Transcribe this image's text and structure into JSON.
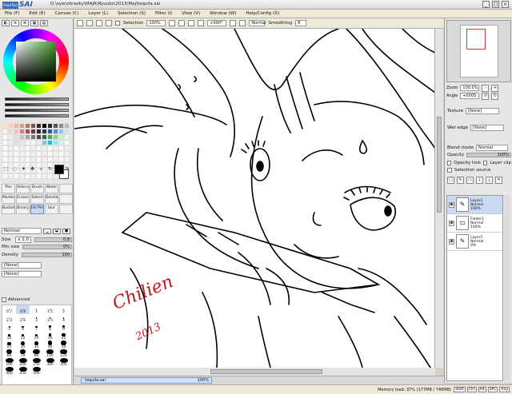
{
  "app": {
    "logo_small": "PaintTool",
    "logo_name": "SAI",
    "title": "D:\\syw\\obrazky\\MAJA\\Ryuuko\\2013\\Maj\\tequila.sai"
  },
  "menu": [
    "File (F)",
    "Edit (E)",
    "Canvas (C)",
    "Layer (L)",
    "Selection (S)",
    "Filter (I)",
    "View (V)",
    "Window (W)",
    "Help/Config (X)"
  ],
  "toolbar": {
    "selection_label": "Selection",
    "zoom": "100%",
    "angle": "+000°",
    "mode": "Normal",
    "smoothing_label": "Smoothing",
    "smoothing_value": "8"
  },
  "tools": [
    "Pen",
    "Airbrush",
    "Brush",
    "Water",
    "",
    "Marker",
    "Eraser",
    "Select",
    "Deselect",
    "",
    "Bucket",
    "Binary",
    "Ink Pen",
    "blur",
    ""
  ],
  "active_tool": "Ink Pen",
  "brush": {
    "blend": "Normal",
    "size_label": "Size",
    "size_mult": "x 1.0",
    "size_value": "0.8",
    "min_size_label": "Min size",
    "min_size_value": "0%",
    "density_label": "Density",
    "density_value": "100",
    "texture_none": "[None]",
    "shape_none": "[None]",
    "advanced_label": "Advanced"
  },
  "brush_sizes": [
    "0.7",
    "0.8",
    "1",
    "1.5",
    "2",
    "2.3",
    "2.6",
    "3",
    "3.5",
    "4",
    "5",
    "6",
    "7",
    "8",
    "9",
    "10",
    "12",
    "14",
    "16",
    "20",
    "25",
    "30",
    "35",
    "40",
    "50",
    "60",
    "70",
    "80",
    "100",
    "120",
    "160",
    "200",
    "250",
    "300",
    "350",
    "400",
    "450",
    "500",
    "",
    ""
  ],
  "navigator": {
    "zoom_label": "Zoom",
    "zoom_value": "100.0%",
    "angle_label": "Angle",
    "angle_value": "+000S"
  },
  "layer_panel": {
    "texture_label": "Texture",
    "texture_value": "[None]",
    "wet_edge_label": "Wet edge",
    "wet_edge_value": "[None]",
    "blend_mode_label": "Blend mode",
    "blend_mode_value": "Normal",
    "opacity_label": "Opacity",
    "opacity_value": "100%",
    "opacity_lock": "Opacity lock",
    "layer_clip": "Layer clip",
    "selection_source": "Selection source"
  },
  "layers": [
    {
      "name": "Layer2",
      "mode": "Normal",
      "opacity": "100%"
    },
    {
      "name": "Folder1",
      "mode": "Normal",
      "opacity": "100%"
    },
    {
      "name": "Layer1",
      "mode": "Normal",
      "opacity": "9%"
    }
  ],
  "doc_tab": {
    "name": "tequila.sai",
    "zoom": "100%"
  },
  "status": {
    "memory": "Memory load: 37% (177MB / 746MB)",
    "keys": [
      "Shift",
      "Ctrl",
      "Alt",
      "SPC",
      "Any"
    ]
  },
  "artwork": {
    "signature": "Chilien",
    "year": "2013"
  },
  "colors": {
    "accent": "#3a72b8",
    "selected": "#c9d9f3"
  }
}
